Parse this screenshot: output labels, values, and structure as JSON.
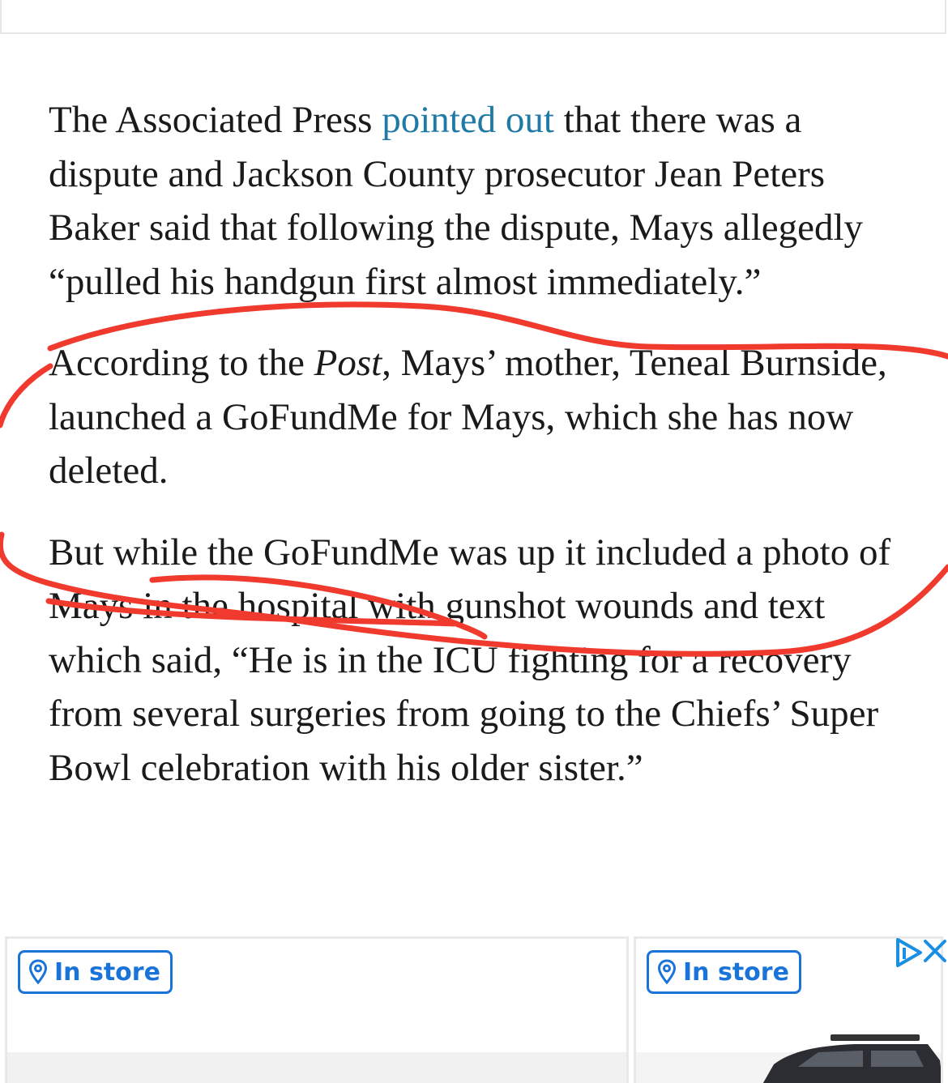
{
  "article": {
    "p1_a": "The Associated Press ",
    "p1_link": "pointed out",
    "p1_b": " that there was a dispute and Jackson County prosecutor Jean Peters Baker said that following the dispute, Mays allegedly “pulled his handgun first almost immediately.”",
    "p2_a": "According to the ",
    "p2_em": "Post",
    "p2_b": ", Mays’ mother, Teneal Burnside, launched a GoFundMe for Mays, which she has now deleted.",
    "p3": "But while the GoFundMe was up it included a photo of Mays in the hospital with gunshot wounds and text which said, “He is in the ICU fighting for a recovery from several surgeries from going to the Chiefs’ Super Bowl celebration with his older sister.”"
  },
  "ads": {
    "left_badge": "In store",
    "right_badge": "In store",
    "badge_color": "#1a73d9",
    "icons": [
      "location-pin-icon",
      "adchoices-icon",
      "close-icon"
    ]
  },
  "annotation": {
    "stroke_color": "#f03a2e"
  },
  "colors": {
    "link": "#1f7aa6",
    "text": "#1a1a1a"
  }
}
